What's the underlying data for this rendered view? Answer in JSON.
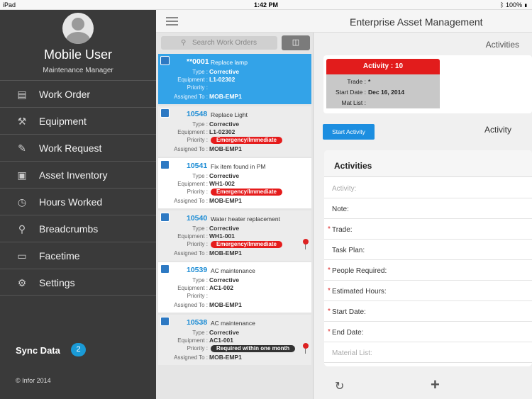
{
  "status": {
    "device": "iPad",
    "time": "1:42 PM",
    "battery": "100%"
  },
  "user": {
    "name": "Mobile User",
    "role": "Maintenance Manager"
  },
  "menu": [
    {
      "label": "Work Order",
      "icon": "clipboard-icon"
    },
    {
      "label": "Equipment",
      "icon": "equipment-icon"
    },
    {
      "label": "Work Request",
      "icon": "request-icon"
    },
    {
      "label": "Asset Inventory",
      "icon": "inventory-icon"
    },
    {
      "label": "Hours Worked",
      "icon": "hours-icon"
    },
    {
      "label": "Breadcrumbs",
      "icon": "location-pin-icon"
    },
    {
      "label": "Facetime",
      "icon": "video-icon"
    },
    {
      "label": "Settings",
      "icon": "gear-icon"
    }
  ],
  "sync": {
    "label": "Sync Data",
    "count": "2"
  },
  "copyright": "© Infor 2014",
  "app": {
    "title": "Enterprise Asset Management"
  },
  "search": {
    "placeholder": "Search Work Orders"
  },
  "labels": {
    "type": "Type :",
    "equipment": "Equipment :",
    "priority": "Priority :",
    "assigned": "Assigned To :"
  },
  "work_orders": [
    {
      "number": "**0001",
      "description": "Replace lamp",
      "type": "Corrective",
      "equipment": "L1-02302",
      "priority": "",
      "assigned": "MOB-EMP1"
    },
    {
      "number": "10548",
      "description": "Replace Light",
      "type": "Corrective",
      "equipment": "L1-02302",
      "priority": "Emergency/Immediate",
      "assigned": "MOB-EMP1"
    },
    {
      "number": "10541",
      "description": "Fix item found in PM",
      "type": "Corrective",
      "equipment": "WH1-002",
      "priority": "Emergency/Immediate",
      "assigned": "MOB-EMP1"
    },
    {
      "number": "10540",
      "description": "Water heater replacement",
      "type": "Corrective",
      "equipment": "WH1-001",
      "priority": "Emergency/Immediate",
      "assigned": "MOB-EMP1"
    },
    {
      "number": "10539",
      "description": "AC maintenance",
      "type": "Corrective",
      "equipment": "AC1-002",
      "priority": "",
      "assigned": "MOB-EMP1"
    },
    {
      "number": "10538",
      "description": "AC maintenance",
      "type": "Corrective",
      "equipment": "AC1-001",
      "priority": "Required within one month",
      "assigned": "MOB-EMP1"
    }
  ],
  "detail": {
    "header": "Activities",
    "card": {
      "title": "Activity :  10",
      "trade_label": "Trade :",
      "trade_value": "*",
      "start_label": "Start Date :",
      "start_value": "Dec 16, 2014",
      "mat_label": "Mat List :",
      "mat_value": ""
    },
    "start_button": "Start Activity",
    "subtitle": "Activity",
    "form_title": "Activities",
    "fields": [
      {
        "label": "Activity:",
        "required": false,
        "placeholder": true
      },
      {
        "label": "Note:",
        "required": false,
        "placeholder": false
      },
      {
        "label": "Trade:",
        "required": true,
        "placeholder": false
      },
      {
        "label": "Task Plan:",
        "required": false,
        "placeholder": false
      },
      {
        "label": "People Required:",
        "required": true,
        "placeholder": false
      },
      {
        "label": "Estimated Hours:",
        "required": true,
        "placeholder": false
      },
      {
        "label": "Start Date:",
        "required": true,
        "placeholder": false
      },
      {
        "label": "End Date:",
        "required": true,
        "placeholder": false
      },
      {
        "label": "Material List:",
        "required": false,
        "placeholder": true
      }
    ]
  },
  "colors": {
    "accent": "#1a9ad6",
    "danger": "#e21c1c",
    "sidebar": "#3a3a3a"
  }
}
